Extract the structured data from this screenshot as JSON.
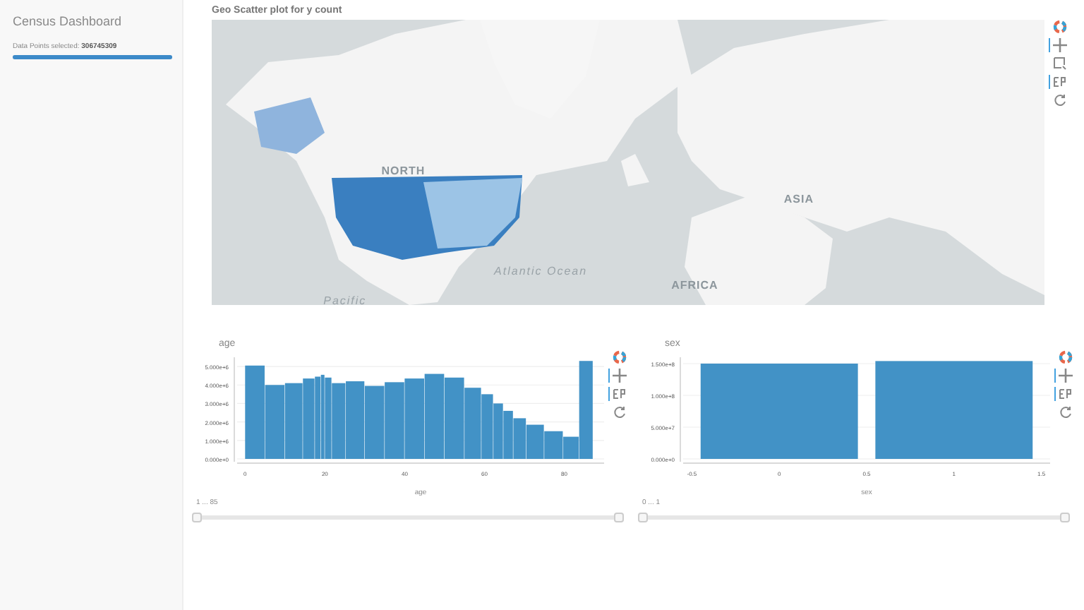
{
  "sidebar": {
    "title": "Census Dashboard",
    "status_label": "Data Points selected:",
    "status_value": "306745309",
    "progress": {
      "level": 1
    }
  },
  "map": {
    "title": "Geo Scatter plot for y count",
    "labels": [
      {
        "text": "NORTH",
        "kind": "region"
      },
      {
        "text": "Atlantic Ocean",
        "kind": "ocean"
      },
      {
        "text": "ASIA",
        "kind": "region"
      },
      {
        "text": "AFRICA",
        "kind": "region"
      },
      {
        "text": "Pacific",
        "kind": "ocean"
      }
    ],
    "toolbar": [
      {
        "kind": "logo",
        "active": false
      },
      {
        "kind": "pan",
        "active": true
      },
      {
        "kind": "box",
        "active": false
      },
      {
        "kind": "wheel",
        "active": true
      },
      {
        "kind": "reset",
        "active": false
      }
    ]
  },
  "charts": [
    {
      "title": "age",
      "slider_label": "1 ... 85",
      "slider": [
        {
          "level": 0
        },
        {
          "level": 1
        }
      ],
      "toolbar": [
        {
          "kind": "logo",
          "active": false
        },
        {
          "kind": "pan",
          "active": true
        },
        {
          "kind": "wheel",
          "active": true
        },
        {
          "kind": "reset",
          "active": false
        }
      ],
      "chart_data": {
        "type": "bar",
        "xlabel": "age",
        "grid": true,
        "x": [
          2.5,
          7.5,
          12.5,
          16.5,
          18.5,
          19.5,
          20.5,
          23,
          27.5,
          32.5,
          37.5,
          42.5,
          47.5,
          52.5,
          57.5,
          61,
          63.5,
          66,
          68.5,
          72.5,
          77.5,
          82,
          85.5
        ],
        "series": [
          {
            "color": "#4292c6",
            "values": [
              5050000,
              4000000,
              4100000,
              4350000,
              4450000,
              4550000,
              4400000,
              4100000,
              4200000,
              3950000,
              4150000,
              4350000,
              4600000,
              4400000,
              3850000,
              3500000,
              3000000,
              2600000,
              2200000,
              1850000,
              1500000,
              1200000,
              5300000
            ]
          }
        ],
        "xlim": [
          -2,
          90
        ],
        "ylim": [
          0,
          5500000
        ],
        "xticks": [
          0,
          20,
          40,
          60,
          80
        ],
        "yticks": [
          {
            "value": 0,
            "label": "0.000e+0"
          },
          {
            "value": 1000000,
            "label": "1.000e+6"
          },
          {
            "value": 2000000,
            "label": "2.000e+6"
          },
          {
            "value": 3000000,
            "label": "3.000e+6"
          },
          {
            "value": 4000000,
            "label": "4.000e+6"
          },
          {
            "value": 5000000,
            "label": "5.000e+6"
          }
        ]
      }
    },
    {
      "title": "sex",
      "slider_label": "0 ... 1",
      "slider": [
        {
          "level": 0
        },
        {
          "level": 1
        }
      ],
      "toolbar": [
        {
          "kind": "logo",
          "active": false
        },
        {
          "kind": "pan",
          "active": true
        },
        {
          "kind": "wheel",
          "active": true
        },
        {
          "kind": "reset",
          "active": false
        }
      ],
      "chart_data": {
        "type": "bar",
        "xlabel": "sex",
        "grid": true,
        "x": [
          0,
          1
        ],
        "series": [
          {
            "color": "#4292c6",
            "values": [
              150000000,
              154000000
            ]
          }
        ],
        "xlim": [
          -0.55,
          1.55
        ],
        "ylim": [
          0,
          160000000
        ],
        "xticks": [
          -0.5,
          0,
          0.5,
          1,
          1.5
        ],
        "yticks": [
          {
            "value": 0,
            "label": "0.000e+0"
          },
          {
            "value": 50000000,
            "label": "5.000e+7"
          },
          {
            "value": 100000000,
            "label": "1.000e+8"
          },
          {
            "value": 150000000,
            "label": "1.500e+8"
          }
        ]
      }
    }
  ]
}
